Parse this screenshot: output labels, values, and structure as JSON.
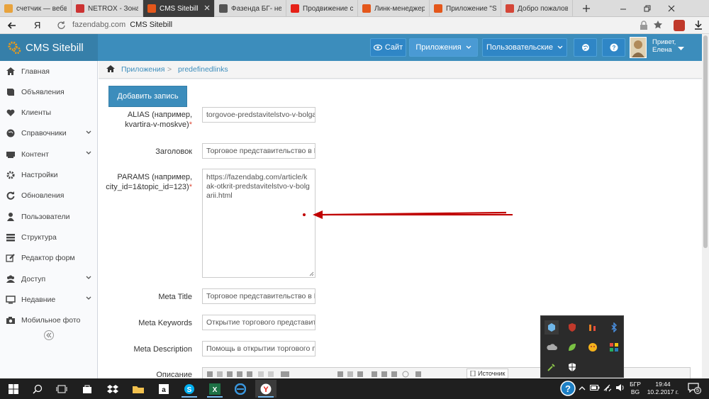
{
  "browser": {
    "tabs": [
      {
        "title": "счетчик — вебви",
        "icon": "bar-chart-icon",
        "color": "#e8a33d",
        "active": false
      },
      {
        "title": "NETROX - Зона с",
        "icon": "netrox-icon",
        "color": "#cc3333",
        "active": false
      },
      {
        "title": "CMS Sitebill",
        "icon": "sitebill-icon",
        "color": "#e4571b",
        "active": true
      },
      {
        "title": "Фазенда БГ- недв",
        "icon": "house-icon",
        "color": "#555555",
        "active": false
      },
      {
        "title": "Продвижение са",
        "icon": "youtube-icon",
        "color": "#e62117",
        "active": false
      },
      {
        "title": "Линк-менеджер",
        "icon": "sitebill-icon",
        "color": "#e4571b",
        "active": false
      },
      {
        "title": "Приложение \"SE",
        "icon": "sitebill-icon",
        "color": "#e4571b",
        "active": false
      },
      {
        "title": "Добро пожалова",
        "icon": "mail-icon",
        "color": "#d44638",
        "active": false
      }
    ],
    "url_domain": "fazendabg.com",
    "url_title": "CMS Sitebill",
    "yandex_glyph": "Я"
  },
  "header": {
    "logo_text": "CMS Sitebill",
    "site_label": "Сайт",
    "apps_label": "Приложения",
    "user_menu_label": "Пользовательские",
    "greeting": "Привет,",
    "user_name": "Елена"
  },
  "sidebar": {
    "items": [
      {
        "label": "Главная",
        "icon": "home-icon",
        "chevron": false
      },
      {
        "label": "Объявления",
        "icon": "book-icon",
        "chevron": false
      },
      {
        "label": "Клиенты",
        "icon": "heart-icon",
        "chevron": false
      },
      {
        "label": "Справочники",
        "icon": "globe-icon",
        "chevron": true
      },
      {
        "label": "Контент",
        "icon": "keyboard-icon",
        "chevron": true
      },
      {
        "label": "Настройки",
        "icon": "gear-icon",
        "chevron": false
      },
      {
        "label": "Обновления",
        "icon": "refresh-icon",
        "chevron": false
      },
      {
        "label": "Пользователи",
        "icon": "user-icon",
        "chevron": false
      },
      {
        "label": "Структура",
        "icon": "list-icon",
        "chevron": false
      },
      {
        "label": "Редактор форм",
        "icon": "edit-icon",
        "chevron": false
      },
      {
        "label": "Доступ",
        "icon": "users-icon",
        "chevron": true
      },
      {
        "label": "Недавние",
        "icon": "monitor-icon",
        "chevron": true
      },
      {
        "label": "Мобильное фото",
        "icon": "camera-icon",
        "chevron": false
      }
    ]
  },
  "breadcrumb": {
    "items": [
      "Приложения",
      "predefinedlinks"
    ],
    "separator": ">"
  },
  "form": {
    "add_button": "Добавить запись",
    "alias_label_1": "ALIAS (например,",
    "alias_label_2": "kvartira-v-moskve)",
    "alias_value": "torgovoe-predstavitelstvo-v-bolgarii",
    "title_label": "Заголовок",
    "title_value": "Торговое представительство в Болгарии",
    "params_label_1": "PARAMS (например,",
    "params_label_2": "city_id=1&topic_id=123)",
    "params_value": "https://fazendabg.com/article/kak-otkrit-predstavitelstvo-v-bolgarii.html",
    "meta_title_label": "Meta Title",
    "meta_title_value": "Торговое представительство в Болгарии",
    "meta_keywords_label": "Meta Keywords",
    "meta_keywords_value": "Открытие торгового представительства",
    "meta_description_label": "Meta Description",
    "meta_description_value": "Помощь в открытии торгового представительства",
    "description_label": "Описание",
    "source_button": "Источник",
    "required_mark": "*"
  },
  "taskbar": {
    "lang_top": "БГР",
    "lang_bottom": "BG",
    "time": "19:44",
    "date": "10.2.2017 г.",
    "notification_count": "5"
  },
  "colors": {
    "header_blue": "#3c8dbc",
    "annotation_arrow": "#c00000"
  }
}
